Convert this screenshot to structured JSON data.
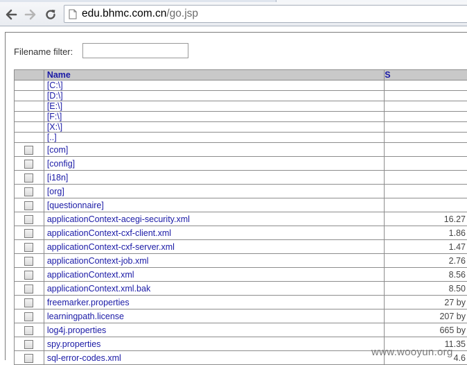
{
  "browser": {
    "url_host": "edu.bhmc.com.cn",
    "url_path": "/go.jsp"
  },
  "filter": {
    "label": "Filename filter:",
    "value": ""
  },
  "table": {
    "headers": [
      "",
      "Name",
      "S"
    ],
    "drives": [
      "[C:\\]",
      "[D:\\]",
      "[E:\\]",
      "[F:\\]",
      "[X:\\]",
      "[..]"
    ],
    "items": [
      {
        "name": "[com]",
        "size": ""
      },
      {
        "name": "[config]",
        "size": ""
      },
      {
        "name": "[i18n]",
        "size": ""
      },
      {
        "name": "[org]",
        "size": ""
      },
      {
        "name": "[questionnaire]",
        "size": ""
      },
      {
        "name": "applicationContext-acegi-security.xml",
        "size": "16.27"
      },
      {
        "name": "applicationContext-cxf-client.xml",
        "size": "1.86"
      },
      {
        "name": "applicationContext-cxf-server.xml",
        "size": "1.47"
      },
      {
        "name": "applicationContext-job.xml",
        "size": "2.76"
      },
      {
        "name": "applicationContext.xml",
        "size": "8.56"
      },
      {
        "name": "applicationContext.xml.bak",
        "size": "8.50"
      },
      {
        "name": "freemarker.properties",
        "size": "27 by"
      },
      {
        "name": "learningpath.license",
        "size": "207 by"
      },
      {
        "name": "log4j.properties",
        "size": "665 by"
      },
      {
        "name": "spy.properties",
        "size": "11.35"
      },
      {
        "name": "sql-error-codes.xml",
        "size": "4.6"
      }
    ]
  },
  "watermark": "www.wooyun.org"
}
